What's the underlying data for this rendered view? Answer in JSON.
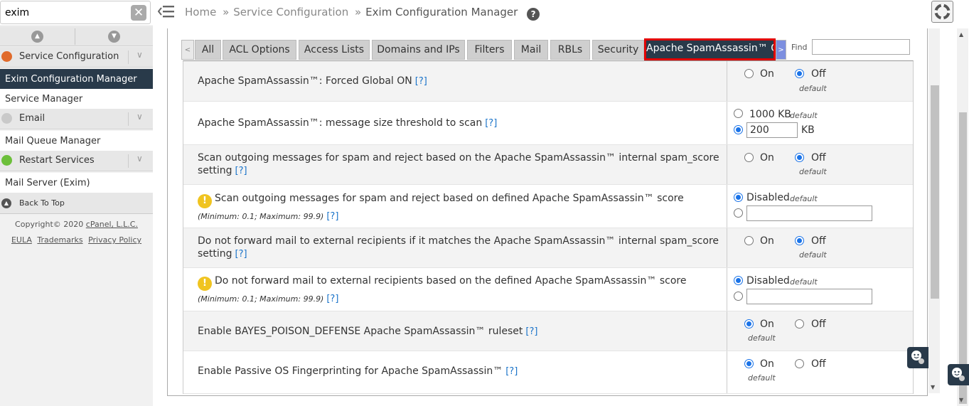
{
  "sidebar": {
    "search": {
      "value": "exim",
      "placeholder": ""
    },
    "categories": {
      "service_configuration": "Service Configuration",
      "email": "Email",
      "restart_services": "Restart Services"
    },
    "items": {
      "exim_config": "Exim Configuration Manager",
      "service_manager": "Service Manager",
      "mail_queue": "Mail Queue Manager",
      "mail_server": "Mail Server (Exim)"
    },
    "back_to_top": "Back To Top",
    "copyright_prefix": "Copyright© 2020 ",
    "copyright_company": "cPanel, L.L.C.",
    "links": [
      "EULA",
      "Trademarks",
      "Privacy Policy"
    ]
  },
  "breadcrumb": {
    "home": "Home",
    "section": "Service Configuration",
    "current": "Exim Configuration Manager",
    "sep": "»"
  },
  "tabs": [
    "All",
    "ACL Options",
    "Access Lists",
    "Domains and IPs",
    "Filters",
    "Mail",
    "RBLs",
    "Security",
    "Apache SpamAssassin™ O"
  ],
  "tab_prev": "<",
  "tab_next": ">",
  "find": {
    "label": "Find",
    "value": ""
  },
  "settings": {
    "forced_global": {
      "label": "Apache SpamAssassin™: Forced Global ON",
      "help": "[?]",
      "on": "On",
      "off": "Off",
      "default": "default"
    },
    "size_threshold": {
      "label": "Apache SpamAssassin™: message size threshold to scan",
      "help": "[?]",
      "opt1": "1000 KB",
      "default": "default",
      "value": "200",
      "unit": "KB"
    },
    "scan_outgoing_internal": {
      "label": "Scan outgoing messages for spam and reject based on the Apache SpamAssassin™ internal spam_score setting",
      "help": "[?]",
      "on": "On",
      "off": "Off",
      "default": "default"
    },
    "scan_outgoing_defined": {
      "label": "Scan outgoing messages for spam and reject based on defined Apache SpamAssassin™ score",
      "note": "(Minimum: 0.1; Maximum: 99.9)",
      "help": "[?]",
      "disabled": "Disabled",
      "default": "default",
      "value": ""
    },
    "no_forward_internal": {
      "label": "Do not forward mail to external recipients if it matches the Apache SpamAssassin™ internal spam_score setting",
      "help": "[?]",
      "on": "On",
      "off": "Off",
      "default": "default"
    },
    "no_forward_defined": {
      "label": "Do not forward mail to external recipients based on the defined Apache SpamAssassin™ score",
      "note": "(Minimum: 0.1; Maximum: 99.9)",
      "help": "[?]",
      "disabled": "Disabled",
      "default": "default",
      "value": ""
    },
    "bayes_poison": {
      "label": "Enable BAYES_POISON_DEFENSE Apache SpamAssassin™ ruleset",
      "help": "[?]",
      "on": "On",
      "off": "Off",
      "default": "default"
    },
    "passive_os": {
      "label": "Enable Passive OS Fingerprinting for Apache SpamAssassin™",
      "help": "[?]",
      "on": "On",
      "off": "Off",
      "default": "default"
    }
  },
  "colors": {
    "active_nav": "#293a4a",
    "highlight_border": "#e10000",
    "link": "#1a73c9",
    "radio": "#1a73e8"
  }
}
